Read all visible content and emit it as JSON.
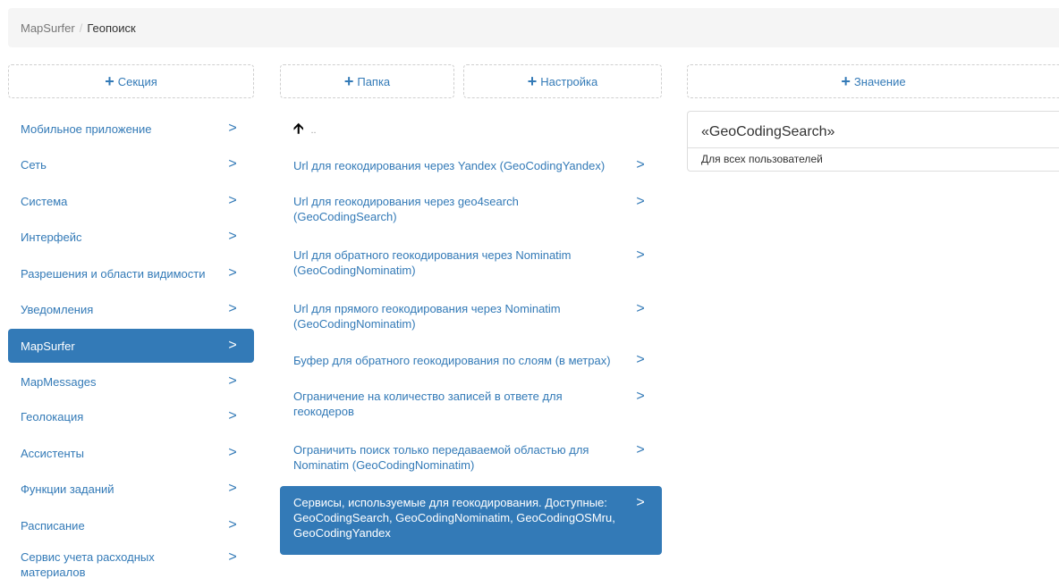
{
  "breadcrumb": {
    "root": "MapSurfer",
    "separator": "/",
    "current": "Геопоиск"
  },
  "buttons": {
    "add_section": "Секция",
    "add_folder": "Папка",
    "add_setting": "Настройка",
    "add_value": "Значение"
  },
  "sections": [
    {
      "label": "Мобильное приложение"
    },
    {
      "label": "Сеть"
    },
    {
      "label": "Система"
    },
    {
      "label": "Интерфейс"
    },
    {
      "label": "Разрешения и области видимости"
    },
    {
      "label": "Уведомления"
    },
    {
      "label": "MapSurfer",
      "active": true
    },
    {
      "label": "MapMessages"
    },
    {
      "label": "Геолокация"
    },
    {
      "label": "Ассистенты"
    },
    {
      "label": "Функции заданий"
    },
    {
      "label": "Расписание"
    },
    {
      "label": "Сервис учета расходных материалов"
    }
  ],
  "folder": {
    "up_label": ".."
  },
  "settings": [
    {
      "label": "Url для геокодирования через Yandex (GeoCodingYandex)"
    },
    {
      "label": "Url для геокодирования через geo4search (GeoCodingSearch)"
    },
    {
      "label": "Url для обратного геокодирования через Nominatim (GeoCodingNominatim)"
    },
    {
      "label": "Url для прямого геокодирования через Nominatim (GeoCodingNominatim)"
    },
    {
      "label": "Буфер для обратного геокодирования по слоям (в метрах)"
    },
    {
      "label": "Ограничение на количество записей в ответе для геокодеров"
    },
    {
      "label": "Ограничить поиск только передаваемой областью для Nominatim (GeoCodingNominatim)"
    },
    {
      "label": "Сервисы, используемые для геокодирования. Доступные: GeoCodingSearch, GeoCodingNominatim, GeoCodingOSMru, GeoCodingYandex",
      "active": true
    }
  ],
  "value_card": {
    "title": "«GeoCodingSearch»",
    "subtitle": "Для всех пользователей"
  },
  "icons": {
    "plus": "plus-icon",
    "chevron": "chevron-right-icon",
    "up": "arrow-up-icon"
  },
  "colors": {
    "accent": "#337ab7",
    "active_bg": "#337ab7",
    "breadcrumb_bg": "#f5f5f5"
  }
}
